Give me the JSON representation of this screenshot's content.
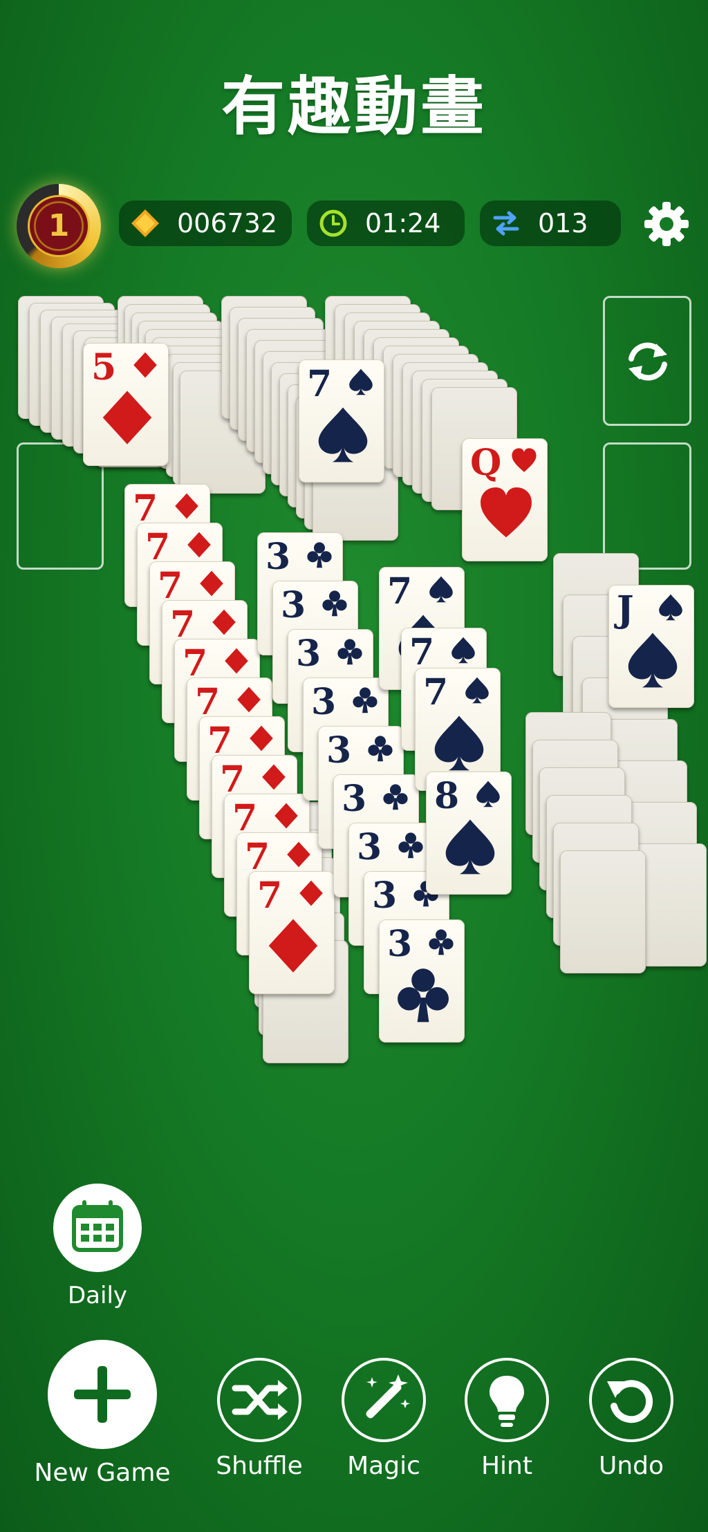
{
  "title": "有趣動畫",
  "level": "1",
  "coins": "006732",
  "timer": "01:24",
  "moves": "013",
  "buttons": {
    "daily": "Daily",
    "new_game": "New Game",
    "shuffle": "Shuffle",
    "magic": "Magic",
    "hint": "Hint",
    "undo": "Undo"
  },
  "cards": [
    {
      "rank": "5",
      "suit": "diamond"
    },
    {
      "rank": "7",
      "suit": "diamond"
    },
    {
      "rank": "7",
      "suit": "diamond"
    },
    {
      "rank": "7",
      "suit": "diamond"
    },
    {
      "rank": "7",
      "suit": "diamond"
    },
    {
      "rank": "7",
      "suit": "diamond"
    },
    {
      "rank": "7",
      "suit": "diamond"
    },
    {
      "rank": "7",
      "suit": "diamond"
    },
    {
      "rank": "7",
      "suit": "diamond"
    },
    {
      "rank": "7",
      "suit": "diamond"
    },
    {
      "rank": "7",
      "suit": "diamond"
    },
    {
      "rank": "7",
      "suit": "diamond"
    },
    {
      "rank": "3",
      "suit": "club"
    },
    {
      "rank": "3",
      "suit": "club"
    },
    {
      "rank": "3",
      "suit": "club"
    },
    {
      "rank": "3",
      "suit": "club"
    },
    {
      "rank": "3",
      "suit": "club"
    },
    {
      "rank": "3",
      "suit": "club"
    },
    {
      "rank": "3",
      "suit": "club"
    },
    {
      "rank": "3",
      "suit": "club"
    },
    {
      "rank": "3",
      "suit": "club"
    },
    {
      "rank": "7",
      "suit": "spade"
    },
    {
      "rank": "7",
      "suit": "spade"
    },
    {
      "rank": "7",
      "suit": "spade"
    },
    {
      "rank": "7",
      "suit": "spade"
    },
    {
      "rank": "8",
      "suit": "spade"
    },
    {
      "rank": "Q",
      "suit": "heart"
    },
    {
      "rank": "J",
      "suit": "spade"
    }
  ]
}
